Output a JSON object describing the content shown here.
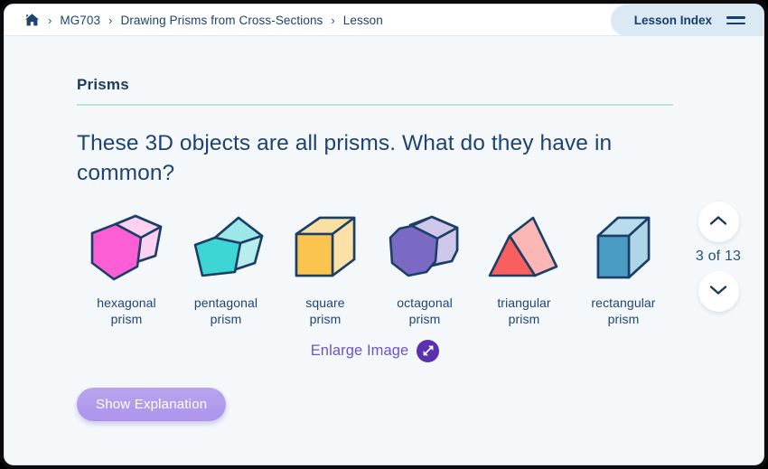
{
  "header": {
    "home_icon": "home-icon",
    "breadcrumb": [
      "MG703",
      "Drawing Prisms from Cross-Sections",
      "Lesson"
    ],
    "separator": "›",
    "lesson_index_label": "Lesson Index",
    "menu_icon": "hamburger-icon"
  },
  "lesson": {
    "section_title": "Prisms",
    "question": "These 3D objects are all prisms. What do they have in common?",
    "enlarge_label": "Enlarge Image",
    "enlarge_icon": "expand-arrow-icon",
    "explain_button_label": "Show Explanation"
  },
  "prisms": [
    {
      "label_line1": "hexagonal",
      "label_line2": "prism",
      "shape": "hexagonal-prism",
      "front_color": "#fc5fd5",
      "side_color": "#fbb6e9",
      "top_color": "#fcd2f0",
      "stroke_color": "#1c3f66"
    },
    {
      "label_line1": "pentagonal",
      "label_line2": "prism",
      "shape": "pentagonal-prism",
      "front_color": "#3ed5d5",
      "side_color": "#b0ecec",
      "top_color": "#9ce8e8",
      "stroke_color": "#1c3f66"
    },
    {
      "label_line1": "square",
      "label_line2": "prism",
      "shape": "square-prism",
      "front_color": "#fbc44f",
      "side_color": "#fbe0a8",
      "top_color": "#fadfa3",
      "stroke_color": "#1c3f66"
    },
    {
      "label_line1": "octagonal",
      "label_line2": "prism",
      "shape": "octagonal-prism",
      "front_color": "#7b6ac4",
      "side_color": "#c5bce6",
      "top_color": "#cfc7ea",
      "stroke_color": "#1c3f66"
    },
    {
      "label_line1": "triangular",
      "label_line2": "prism",
      "shape": "triangular-prism",
      "front_color": "#fa5f5f",
      "side_color": "#fbb6b6",
      "top_color": "#fbb6b6",
      "stroke_color": "#1c3f66"
    },
    {
      "label_line1": "rectangular",
      "label_line2": "prism",
      "shape": "rectangular-prism",
      "front_color": "#4a9cc4",
      "side_color": "#aed6e8",
      "top_color": "#b8dced",
      "stroke_color": "#1c3f66"
    }
  ],
  "navigation": {
    "up_icon": "chevron-up-icon",
    "down_icon": "chevron-down-icon",
    "page_indicator": "3 of 13"
  },
  "colors": {
    "accent_purple": "#5a2fb0",
    "navy": "#1e4373",
    "rule_teal": "#c3e3dd",
    "page_bg": "#f5f8fb"
  }
}
